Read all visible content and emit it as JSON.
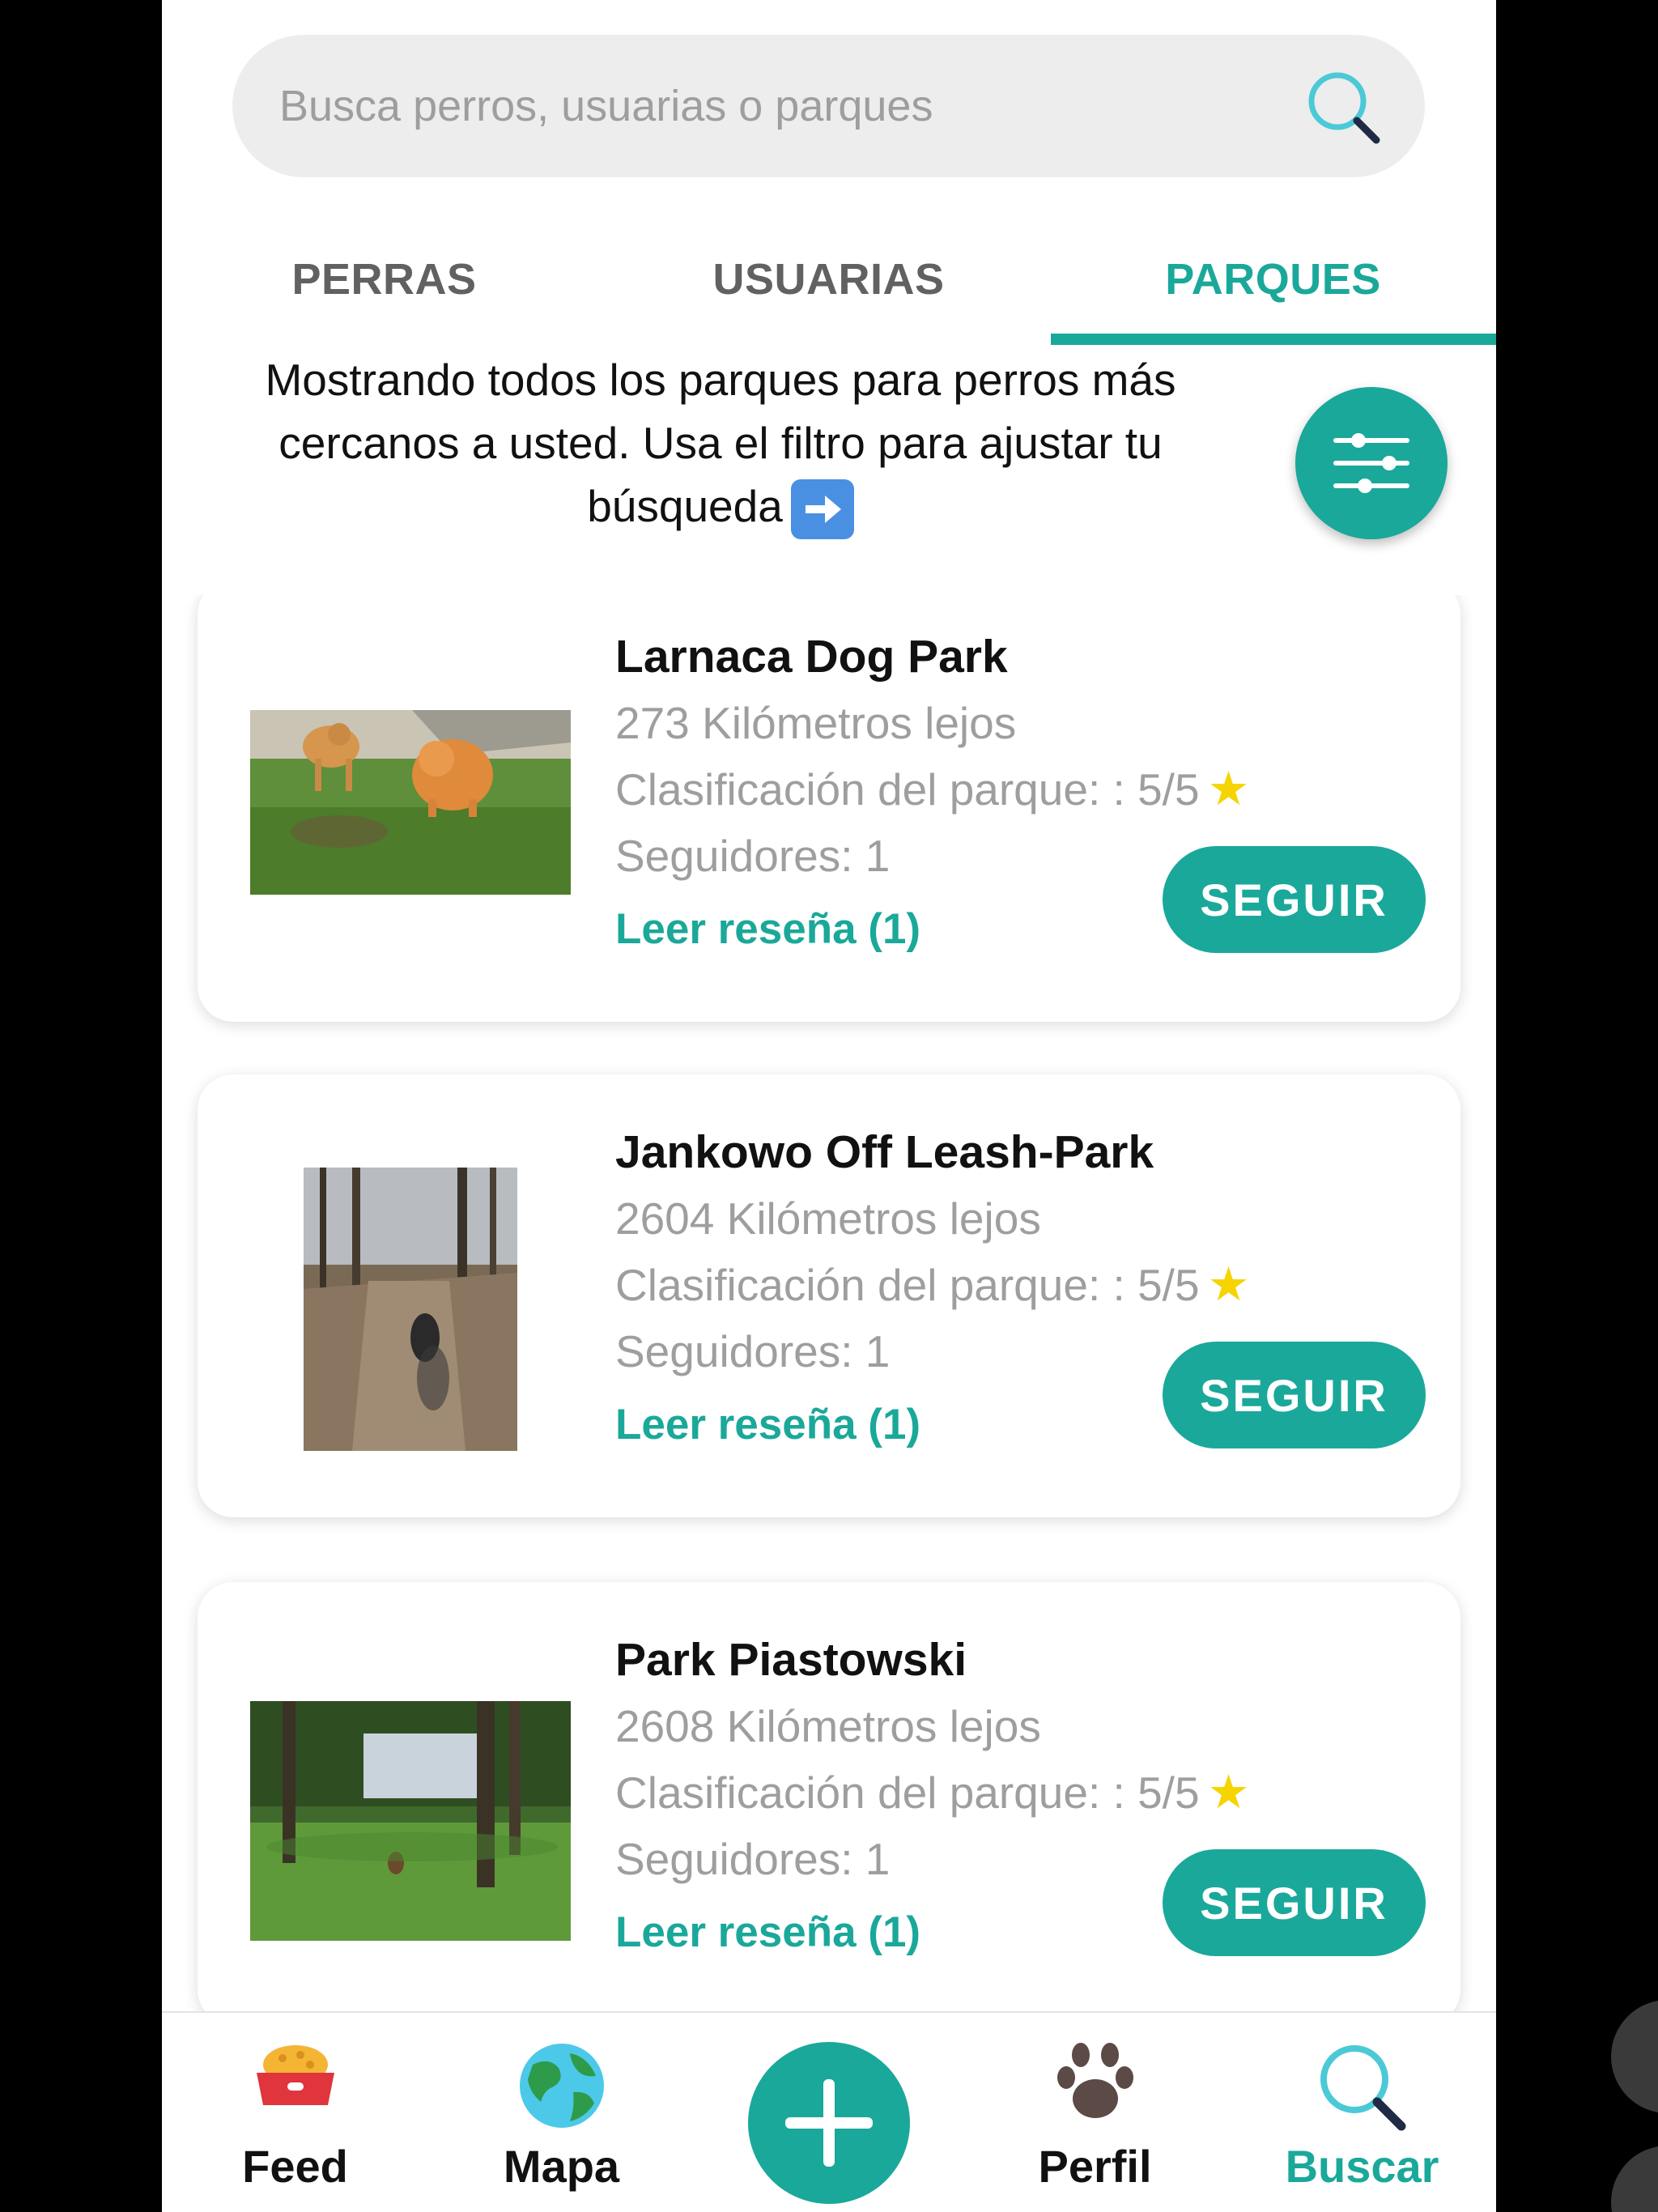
{
  "search": {
    "placeholder": "Busca perros, usuarias o parques"
  },
  "tabs": [
    {
      "label": "PERRAS"
    },
    {
      "label": "USUARIAS"
    },
    {
      "label": "PARQUES",
      "active": true
    }
  ],
  "info": {
    "line1": "Mostrando todos los parques para perros más",
    "line2": "cercanos a usted. Usa el filtro para ajustar tu",
    "line3": "búsqueda"
  },
  "parks": [
    {
      "name": "Larnaca Dog Park",
      "distance": "273 Kilómetros lejos",
      "rating": "Clasificación del parque: : 5/5",
      "followers": "Seguidores: 1",
      "review": "Leer reseña (1)",
      "follow": "SEGUIR"
    },
    {
      "name": "Jankowo Off Leash-Park",
      "distance": "2604 Kilómetros lejos",
      "rating": "Clasificación del parque: : 5/5",
      "followers": "Seguidores: 1",
      "review": "Leer reseña (1)",
      "follow": "SEGUIR"
    },
    {
      "name": "Park Piastowski",
      "distance": "2608 Kilómetros lejos",
      "rating": "Clasificación del parque: : 5/5",
      "followers": "Seguidores: 1",
      "review": "Leer reseña (1)",
      "follow": "SEGUIR"
    }
  ],
  "nav": {
    "feed": "Feed",
    "map": "Mapa",
    "profile": "Perfil",
    "search": "Buscar"
  },
  "colors": {
    "accent": "#1aa89a",
    "star": "#f5d400"
  }
}
